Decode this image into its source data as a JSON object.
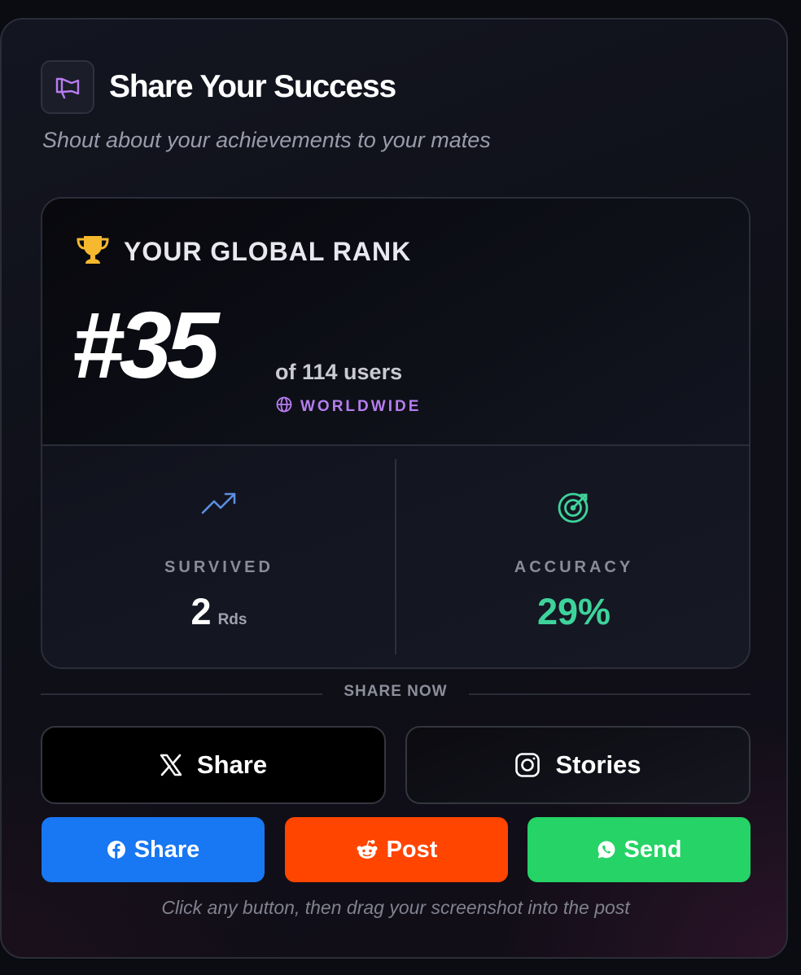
{
  "header": {
    "icon": "megaphone-icon",
    "title": "Share Your Success",
    "subtitle": "Shout about your achievements to your mates"
  },
  "rank_card": {
    "label_icon": "trophy-icon",
    "label": "YOUR GLOBAL RANK",
    "rank": "#35",
    "of_users": "of 114 users",
    "scope_icon": "globe-icon",
    "scope": "WORLDWIDE",
    "stats": [
      {
        "icon": "trending-up-icon",
        "label": "SURVIVED",
        "value": "2",
        "unit": "Rds"
      },
      {
        "icon": "target-icon",
        "label": "ACCURACY",
        "value": "29%"
      }
    ]
  },
  "share_now": "SHARE NOW",
  "buttons": {
    "x": {
      "icon": "x-logo-icon",
      "label": "Share"
    },
    "instagram": {
      "icon": "instagram-icon",
      "label": "Stories"
    },
    "facebook": {
      "icon": "facebook-icon",
      "label": "Share"
    },
    "reddit": {
      "icon": "reddit-icon",
      "label": "Post"
    },
    "whatsapp": {
      "icon": "whatsapp-icon",
      "label": "Send"
    }
  },
  "footnote": "Click any button, then drag your screenshot into the post",
  "colors": {
    "accent_purple": "#b67df0",
    "trophy_gold": "#f5b82e",
    "accuracy_green": "#3ed39b",
    "trend_blue": "#5b8fe0",
    "facebook": "#1877f2",
    "reddit": "#ff4500",
    "whatsapp": "#25d366"
  }
}
